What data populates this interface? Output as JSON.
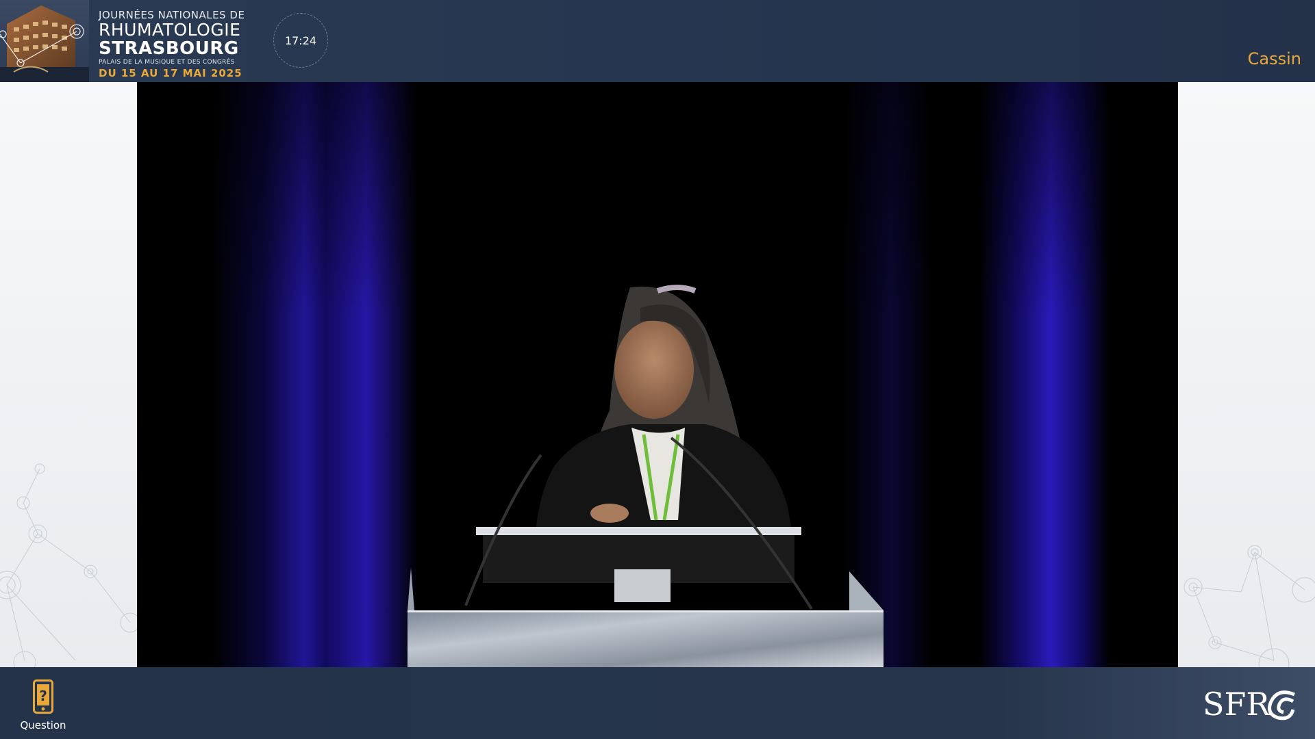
{
  "header": {
    "event": {
      "line1": "JOURNÉES NATIONALES DE",
      "line2": "RHUMATOLOGIE",
      "line3": "STRASBOURG",
      "line4": "PALAIS DE LA MUSIQUE ET DES CONGRÈS",
      "line5": "DU 15 AU 17 MAI 2025"
    },
    "clock": "17:24",
    "room": "Cassin"
  },
  "footer": {
    "question_label": "Question",
    "logo_name": "SFR"
  },
  "colors": {
    "header_bg": "#2b3a52",
    "footer_bg": "#243349",
    "accent_gold": "#e8a93a",
    "video_bg": "#000000"
  },
  "icons": {
    "question": "phone-question-icon",
    "logo": "sfr-logo"
  }
}
